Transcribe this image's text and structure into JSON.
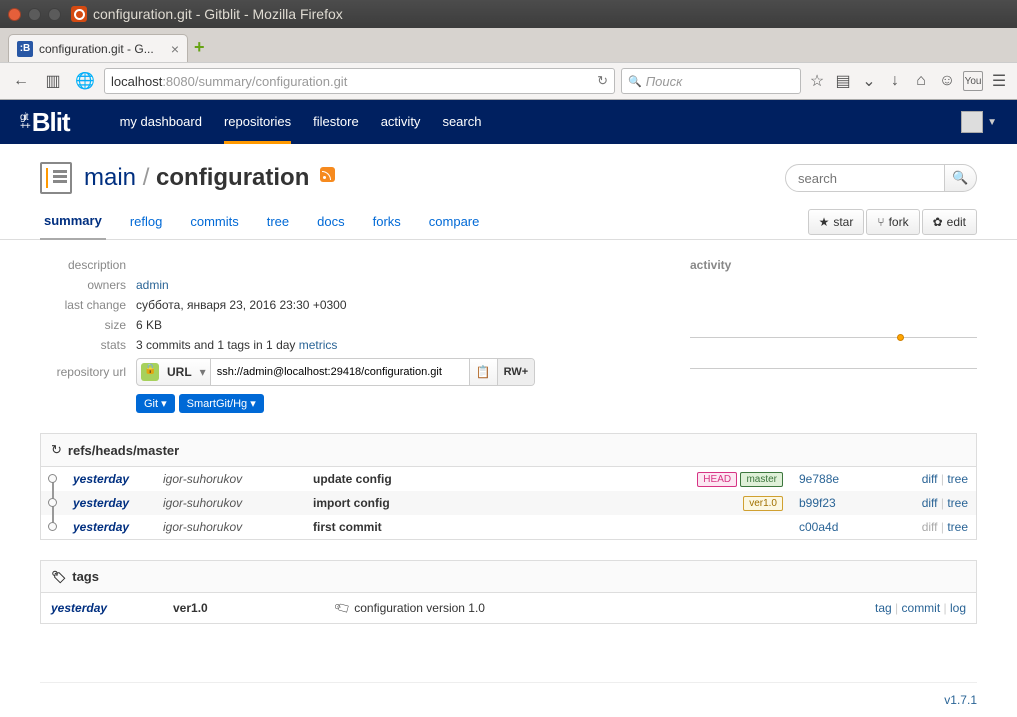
{
  "os": {
    "title": "configuration.git - Gitblit - Mozilla Firefox"
  },
  "browser": {
    "tab_label": "configuration.git - G...",
    "url_host": "localhost",
    "url_port": ":8080",
    "url_path": "/summary/configuration.git",
    "search_placeholder": "Поиск"
  },
  "header": {
    "nav": {
      "dashboard": "my dashboard",
      "repositories": "repositories",
      "filestore": "filestore",
      "activity": "activity",
      "search": "search"
    }
  },
  "repo": {
    "parent": "main",
    "name": "configuration",
    "search_placeholder": "search",
    "sub_tabs": {
      "summary": "summary",
      "reflog": "reflog",
      "commits": "commits",
      "tree": "tree",
      "docs": "docs",
      "forks": "forks",
      "compare": "compare"
    },
    "actions": {
      "star": "star",
      "fork": "fork",
      "edit": "edit"
    }
  },
  "meta": {
    "labels": {
      "description": "description",
      "owners": "owners",
      "last_change": "last change",
      "size": "size",
      "stats": "stats",
      "repo_url": "repository url"
    },
    "owners": "admin",
    "last_change": "суббота, января 23, 2016 23:30 +0300",
    "size": "6 KB",
    "stats": "3 commits and 1 tags in 1 day",
    "metrics": "metrics",
    "url_label": "URL",
    "url_value": "ssh://admin@localhost:29418/configuration.git",
    "rw": "RW+",
    "git_btn": "Git",
    "smartgit_btn": "SmartGit/Hg"
  },
  "activity_label": "activity",
  "ref_head": "refs/heads/master",
  "commits": [
    {
      "date": "yesterday",
      "author": "igor-suhorukov",
      "msg": "update config",
      "labels": [
        "HEAD",
        "master"
      ],
      "hash": "9e788e",
      "diff": true
    },
    {
      "date": "yesterday",
      "author": "igor-suhorukov",
      "msg": "import config",
      "labels": [
        "ver1.0"
      ],
      "hash": "b99f23",
      "diff": true
    },
    {
      "date": "yesterday",
      "author": "igor-suhorukov",
      "msg": "first commit",
      "labels": [],
      "hash": "c00a4d",
      "diff": false
    }
  ],
  "link_labels": {
    "diff": "diff",
    "tree": "tree",
    "tag": "tag",
    "commit": "commit",
    "log": "log"
  },
  "tags_head": "tags",
  "tags": [
    {
      "date": "yesterday",
      "name": "ver1.0",
      "msg": "configuration version 1.0"
    }
  ],
  "footer_version": "v1.7.1"
}
